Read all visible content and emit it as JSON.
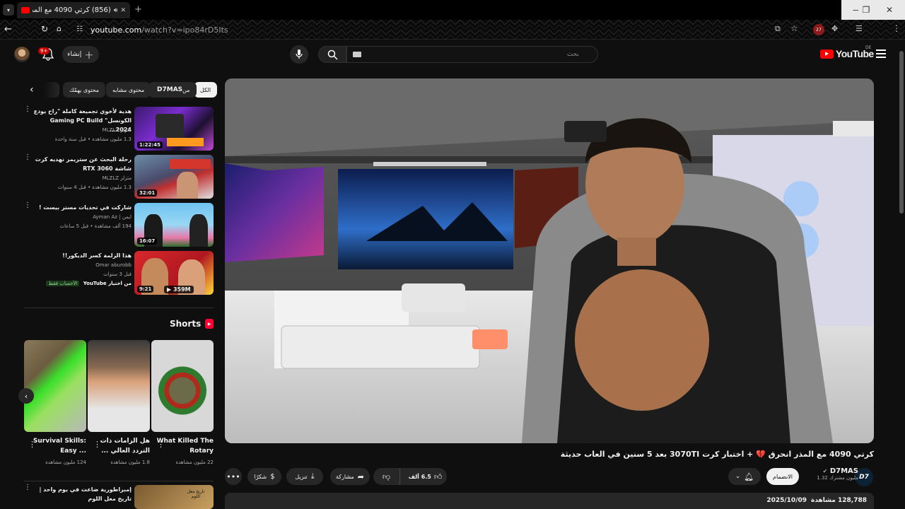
{
  "browser": {
    "tab_title": "(856) كرتي 4090 مع المذر ا...",
    "url_host": "youtube.com",
    "url_path": "/watch?v=ipo84rD5Its",
    "extension_badge": "27"
  },
  "masthead": {
    "create_label": "إنشاء",
    "notif_count": "9+",
    "search_placeholder": "بحث",
    "logo_text": "YouTube",
    "country_code": "DE"
  },
  "chips": [
    "الكل",
    "من D7MAS",
    "محتوى مشابه",
    "محتوى يهمّك"
  ],
  "chips_bold": "D7MAS",
  "chips_from": "من",
  "recommendations": [
    {
      "title": "هدية لأخوي تجميعة كاملة \"راح يودع الكونسل\" Gaming PC Build 2024...",
      "channel": "مثزلز MLZLZ",
      "meta": "1.3 مليون مشاهدة • قبل سنة واحدة",
      "duration": "1:22:45"
    },
    {
      "title": "رحلة البحث عن ستريمر نهديه كرت شاشة RTX 3060",
      "channel": "مثزلز MLZLZ",
      "meta": "1.3 مليون مشاهدة • قبل 4 سنوات",
      "duration": "32:01"
    },
    {
      "title": "شاركت في تحديات مستر بيست !",
      "channel": "ايمن | Ayman Az",
      "meta": "194 ألف مشاهدة • قبل 5 ساعات",
      "duration": "16:07"
    },
    {
      "title": "هذا الزلمة كسر الديكور!!",
      "channel": "Omar aburobb",
      "meta": "قبل 3 سنوات",
      "duration": "9:21",
      "badge_from": "من اختيار YouTube",
      "badge_tag": "الأحساب فقط",
      "overlay": "359M"
    }
  ],
  "shorts": {
    "heading": "Shorts",
    "items": [
      {
        "title": "What Killed The Rotary",
        "views": "22 مليون مشاهدة"
      },
      {
        "title": "هل الزامات ذات التردد العالي ...",
        "views": "1.8 مليون مشاهدة"
      },
      {
        "title": "Survival Skills: Easy ...",
        "views": "124 مليون مشاهدة"
      }
    ]
  },
  "next_rec": {
    "title": "إمبراطورية ضاعت في يوم واحد | تاريخ معل اللوم",
    "thumb_text": "تاريخ معل اللوم"
  },
  "video": {
    "title": "كرتي 4090 مع المذر انحرق 💔 + اختبار كرت 3070TI بعد 5 سنين في العاب حديثة",
    "channel": "D7MAS",
    "subs": "1.32 مليون مشترك",
    "subscribe": "الانضمام",
    "likes": "6.5 ألف",
    "share": "مشاركة",
    "download": "تنزيل",
    "thanks": "شكرًا",
    "views": "128,788 مشاهدة",
    "date": "2025/10/09",
    "avatar_text": "D7"
  }
}
